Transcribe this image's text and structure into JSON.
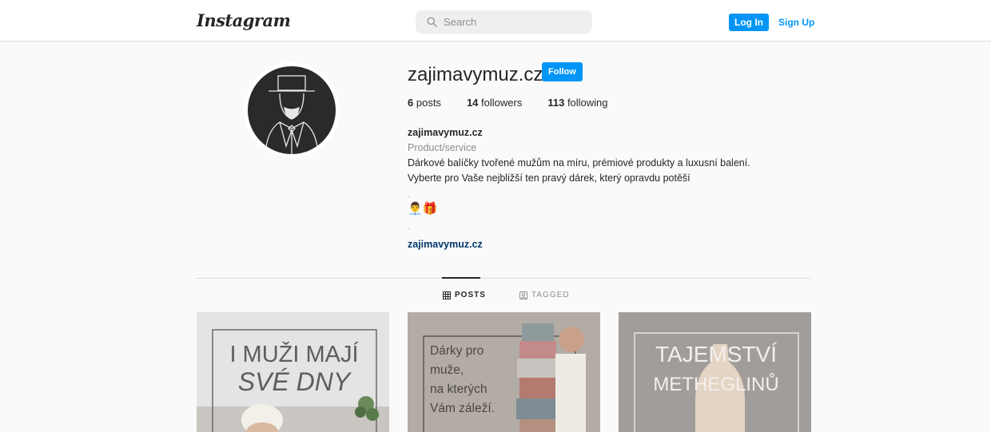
{
  "header": {
    "logo_text": "Instagram",
    "search_placeholder": "Search",
    "login_label": "Log In",
    "signup_label": "Sign Up"
  },
  "profile": {
    "username": "zajimavymuz.cz",
    "follow_label": "Follow",
    "stats": {
      "posts_count": "6",
      "posts_label": "posts",
      "followers_count": "14",
      "followers_label": "followers",
      "following_count": "113",
      "following_label": "following"
    },
    "bio": {
      "display_name": "zajimavymuz.cz",
      "category": "Product/service",
      "line1": "Dárkové balíčky tvořené mužům na míru, prémiové produkty a luxusní balení.",
      "line2": "Vyberte pro Vaše nejbližší ten pravý dárek, který opravdu potěší",
      "dot1": ".",
      "emoji": "👨‍💼🎁",
      "dot2": ".",
      "website": "zajimavymuz.cz"
    }
  },
  "tabs": {
    "posts_label": "POSTS",
    "tagged_label": "TAGGED"
  },
  "posts": [
    {
      "line1": "I MUŽI MAJÍ",
      "line2": "SVÉ DNY"
    },
    {
      "lines": [
        "Dárky pro",
        "muže,",
        "na kterých",
        "Vám záleží."
      ]
    },
    {
      "line1": "TAJEMSTVÍ",
      "line2": "METHEGLINŮ"
    }
  ],
  "colors": {
    "accent": "#0095f6",
    "link_dark": "#00376b",
    "muted": "#8e8e8e"
  }
}
